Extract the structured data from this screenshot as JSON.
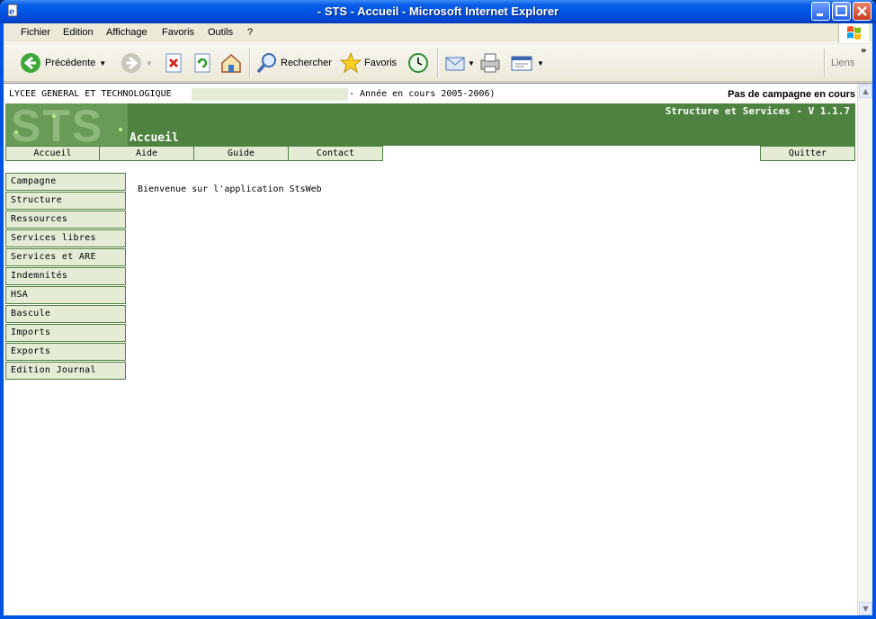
{
  "window": {
    "title": "- STS - Accueil - Microsoft Internet Explorer"
  },
  "menubar": {
    "items": [
      "Fichier",
      "Edition",
      "Affichage",
      "Favoris",
      "Outils",
      "?"
    ]
  },
  "toolbar": {
    "back_label": "Précédente",
    "search_label": "Rechercher",
    "favorites_label": "Favoris",
    "links_label": "Liens"
  },
  "page": {
    "etablissement": "LYCEE GENERAL ET TECHNOLOGIQUE",
    "annee": "- Année en cours 2005-2006)",
    "campagne": "Pas de campagne en cours",
    "logo_text": "STS",
    "app_title": "Structure et Services - V 1.1.7",
    "heading": "Accueil",
    "tabs": [
      "Accueil",
      "Aide",
      "Guide",
      "Contact"
    ],
    "quit_label": "Quitter",
    "side_menu": [
      "Campagne",
      "Structure",
      "Ressources",
      "Services libres",
      "Services et ARE",
      "Indemnités",
      "HSA",
      "Bascule",
      "Imports",
      "Exports",
      "Edition Journal"
    ],
    "welcome": "Bienvenue sur l'application StsWeb"
  },
  "colors": {
    "banner": "#4e8240",
    "tab_bg": "#e4ecd6",
    "titlebar": "#0054e3"
  }
}
